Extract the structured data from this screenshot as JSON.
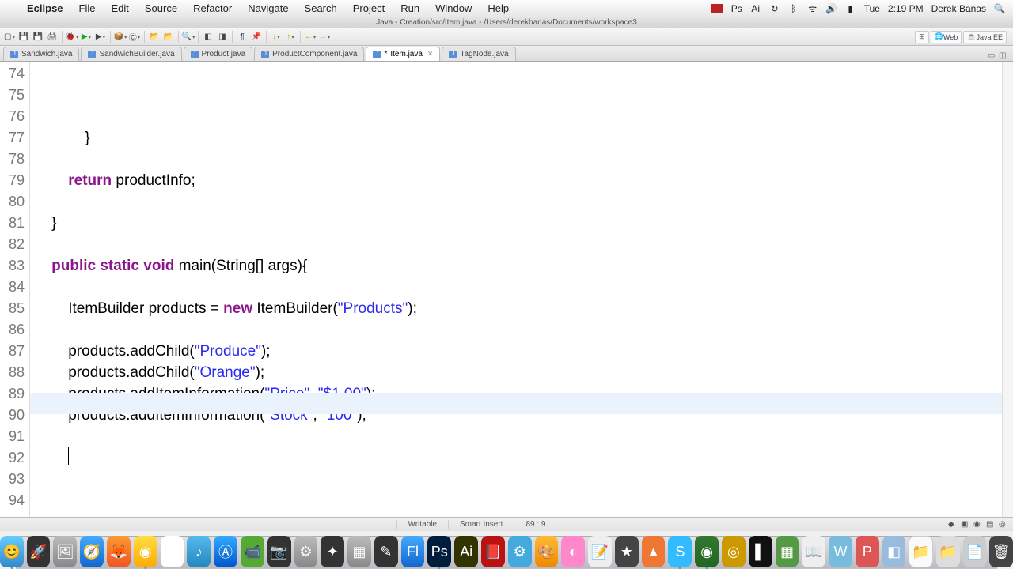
{
  "menubar": {
    "apple": "",
    "app": "Eclipse",
    "items": [
      "File",
      "Edit",
      "Source",
      "Refactor",
      "Navigate",
      "Search",
      "Project",
      "Run",
      "Window",
      "Help"
    ],
    "right": {
      "ps": "Ps",
      "ai": "Ai",
      "battery": "▮",
      "wifi": "ᯤ",
      "vol": "🔊",
      "bt": "ᛒ",
      "day": "Tue",
      "time": "2:19 PM",
      "user": "Derek Banas",
      "search": "🔍"
    }
  },
  "window_title": "Java - Creation/src/Item.java - /Users/derekbanas/Documents/workspace3",
  "tabs": [
    {
      "label": "Sandwich.java",
      "active": false,
      "dirty": false
    },
    {
      "label": "SandwichBuilder.java",
      "active": false,
      "dirty": false
    },
    {
      "label": "Product.java",
      "active": false,
      "dirty": false
    },
    {
      "label": "ProductComponent.java",
      "active": false,
      "dirty": false
    },
    {
      "label": "Item.java",
      "active": true,
      "dirty": true
    },
    {
      "label": "TagNode.java",
      "active": false,
      "dirty": false
    }
  ],
  "code": {
    "lines": [
      {
        "n": 74,
        "t": "            }"
      },
      {
        "n": 75,
        "t": ""
      },
      {
        "n": 76,
        "t": "        ",
        "seg": [
          {
            "k": "kw",
            "v": "return"
          },
          {
            "k": "",
            "v": " productInfo;"
          }
        ]
      },
      {
        "n": 77,
        "t": ""
      },
      {
        "n": 78,
        "t": "    }"
      },
      {
        "n": 79,
        "t": ""
      },
      {
        "n": 80,
        "seg": [
          {
            "k": "",
            "v": "    "
          },
          {
            "k": "kw",
            "v": "public"
          },
          {
            "k": "",
            "v": " "
          },
          {
            "k": "kw",
            "v": "static"
          },
          {
            "k": "",
            "v": " "
          },
          {
            "k": "kw",
            "v": "void"
          },
          {
            "k": "",
            "v": " main(String[] args){"
          }
        ]
      },
      {
        "n": 81,
        "t": ""
      },
      {
        "n": 82,
        "seg": [
          {
            "k": "",
            "v": "        ItemBuilder products = "
          },
          {
            "k": "kw",
            "v": "new"
          },
          {
            "k": "",
            "v": " ItemBuilder("
          },
          {
            "k": "str",
            "v": "\"Products\""
          },
          {
            "k": "",
            "v": ");"
          }
        ]
      },
      {
        "n": 83,
        "t": ""
      },
      {
        "n": 84,
        "seg": [
          {
            "k": "",
            "v": "        products.addChild("
          },
          {
            "k": "str",
            "v": "\"Produce\""
          },
          {
            "k": "",
            "v": ");"
          }
        ]
      },
      {
        "n": 85,
        "seg": [
          {
            "k": "",
            "v": "        products.addChild("
          },
          {
            "k": "str",
            "v": "\"Orange\""
          },
          {
            "k": "",
            "v": ");"
          }
        ]
      },
      {
        "n": 86,
        "seg": [
          {
            "k": "",
            "v": "        products.addItemInformation("
          },
          {
            "k": "str",
            "v": "\"Price\""
          },
          {
            "k": "",
            "v": ", "
          },
          {
            "k": "str",
            "v": "\"$1.00\""
          },
          {
            "k": "",
            "v": ");"
          }
        ]
      },
      {
        "n": 87,
        "seg": [
          {
            "k": "",
            "v": "        products.addItemInformation("
          },
          {
            "k": "str",
            "v": "\"Stock\""
          },
          {
            "k": "",
            "v": ", "
          },
          {
            "k": "str",
            "v": "\"100\""
          },
          {
            "k": "",
            "v": ");"
          }
        ]
      },
      {
        "n": 88,
        "t": ""
      },
      {
        "n": 89,
        "t": "        ",
        "cursor": true
      },
      {
        "n": 90,
        "t": ""
      },
      {
        "n": 91,
        "t": ""
      },
      {
        "n": 92,
        "t": ""
      },
      {
        "n": 93,
        "t": "    }"
      },
      {
        "n": 94,
        "t": ""
      }
    ]
  },
  "status": {
    "writable": "Writable",
    "insert": "Smart Insert",
    "pos": "89 : 9"
  },
  "perspectives": {
    "web": "Web",
    "java": "Java EE"
  },
  "dock_items": [
    "Finder",
    "Launchpad",
    "Preview",
    "Safari",
    "Firefox",
    "Chrome",
    "Calendar",
    "iTunes",
    "AppStore",
    "FaceTime",
    "ImageCap",
    "Automator",
    "Camera",
    "Term",
    "Vim",
    "AE",
    "Flash",
    "Ps",
    "Ai",
    "Reader",
    "Gear",
    "Paint",
    "DB",
    "Notes",
    "iMovie",
    "VLC",
    "Skype",
    "Eclipse",
    "CodeRunner",
    "Terminal",
    "VirtualBox",
    "Steam",
    "Pages",
    "Word",
    "Excel",
    "Folder",
    "Folder2",
    "Trash"
  ]
}
